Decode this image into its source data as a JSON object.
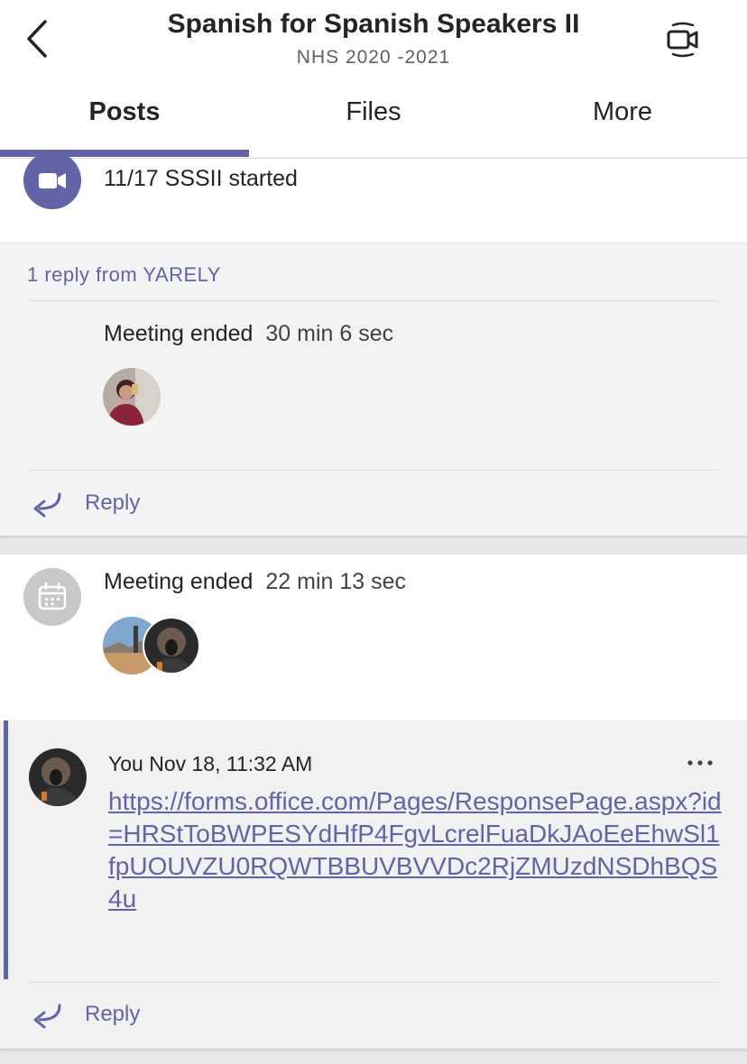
{
  "header": {
    "title": "Spanish for Spanish Speakers II",
    "subtitle": "NHS 2020 -2021",
    "back_icon": "chevron-left-icon",
    "video_icon": "video-call-icon"
  },
  "tabs": [
    {
      "label": "Posts",
      "active": true
    },
    {
      "label": "Files",
      "active": false
    },
    {
      "label": "More",
      "active": false
    }
  ],
  "colors": {
    "accent": "#6264a7",
    "background": "#e8e8e8"
  },
  "thread1": {
    "started_text": "11/17 SSSII started",
    "reply_count_text": "1 reply from YARELY",
    "reply": {
      "label": "Meeting ended",
      "duration": "30 min 6 sec"
    },
    "reply_button": "Reply"
  },
  "thread2": {
    "label": "Meeting ended",
    "duration": "22 min 13 sec"
  },
  "thread3": {
    "meta": "You Nov 18, 11:32 AM",
    "link": "https://forms.office.com/Pages/ResponsePage.aspx?id=HRStToBWPESYdHfP4FgvLcrelFuaDkJAoEeEhwSl1fpUOUVZU0RQWTBBUVBVVDc2RjZMUzdNSDhBQS4u",
    "reply_button": "Reply"
  }
}
